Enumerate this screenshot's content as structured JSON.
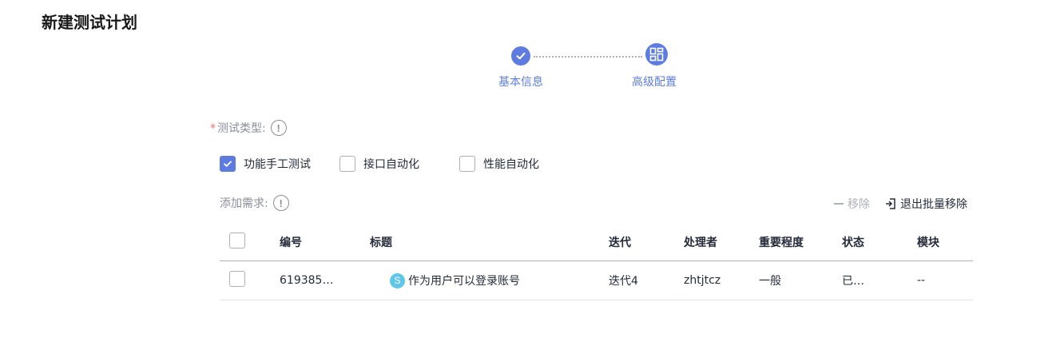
{
  "page": {
    "title": "新建测试计划"
  },
  "stepper": {
    "steps": [
      {
        "label": "基本信息",
        "status": "completed",
        "icon": "check-icon"
      },
      {
        "label": "高级配置",
        "status": "active",
        "icon": "layout-icon"
      }
    ]
  },
  "test_type": {
    "label": "测试类型:",
    "required": "*",
    "info": "!",
    "options": [
      {
        "label": "功能手工测试",
        "checked": true
      },
      {
        "label": "接口自动化",
        "checked": false
      },
      {
        "label": "性能自动化",
        "checked": false
      }
    ]
  },
  "requirements": {
    "label": "添加需求:",
    "info": "!",
    "remove_label": "移除",
    "exit_batch_label": "退出批量移除",
    "remove_icon": "minus-icon",
    "exit_icon": "exit-icon"
  },
  "table": {
    "columns": [
      "编号",
      "标题",
      "迭代",
      "处理者",
      "重要程度",
      "状态",
      "模块"
    ],
    "rows": [
      {
        "id": "619385…",
        "type_icon": "S",
        "title": "作为用户可以登录账号",
        "iteration": "迭代4",
        "assignee": "zhtjtcz",
        "priority": "一般",
        "status": "已…",
        "module": "--"
      }
    ]
  },
  "colors": {
    "accent": "#5e7ce0",
    "story_icon": "#5fc6e8",
    "required": "#f66f6a"
  }
}
